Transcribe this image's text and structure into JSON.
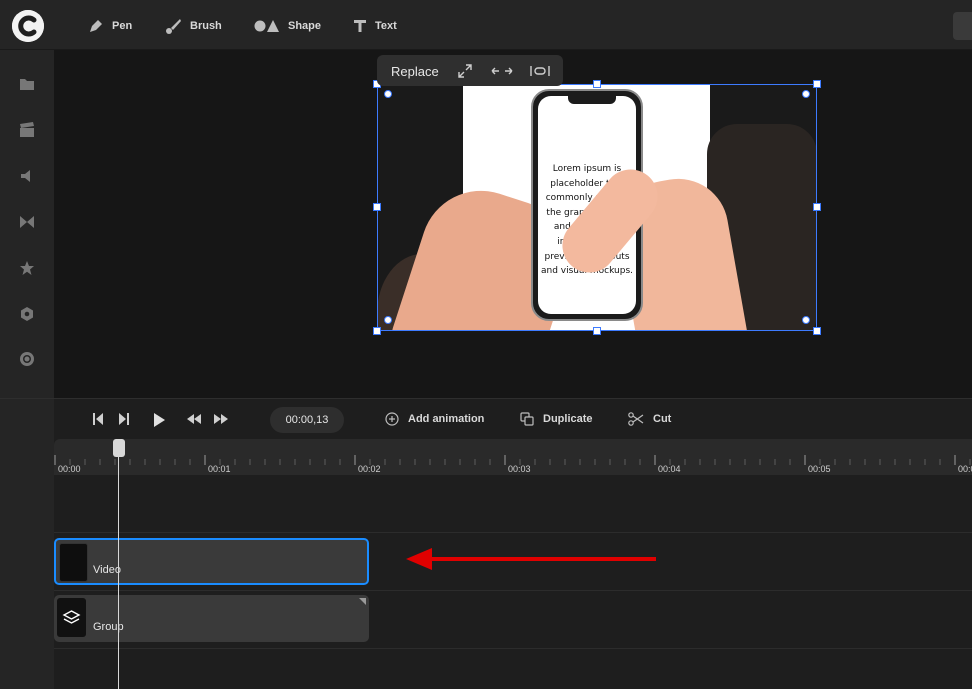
{
  "toolbar": {
    "tools": [
      {
        "label": "Pen",
        "icon": "pen-icon"
      },
      {
        "label": "Brush",
        "icon": "brush-icon"
      },
      {
        "label": "Shape",
        "icon": "shape-icon"
      },
      {
        "label": "Text",
        "icon": "text-icon"
      }
    ]
  },
  "sidebar": {
    "icons": [
      "folder-icon",
      "clapperboard-icon",
      "speaker-icon",
      "transition-icon",
      "star-icon",
      "hexagon-icon",
      "record-icon"
    ]
  },
  "canvas": {
    "floating_toolbar": {
      "replace_label": "Replace"
    },
    "phone_text": "Lorem ipsum is placeholder text commonly used in the graphic, print, and publishing industries for previewing layouts and visual mockups."
  },
  "timeline": {
    "current_time": "00:00,13",
    "actions": {
      "add_animation": "Add animation",
      "duplicate": "Duplicate",
      "cut": "Cut"
    },
    "ruler_labels": [
      "00:00",
      "00:01",
      "00:02",
      "00:03",
      "00:04",
      "00:05",
      "00:0"
    ],
    "tracks": {
      "video_label": "Video",
      "group_label": "Group"
    },
    "highlight_color": "#1a8cff",
    "annotation_arrow_color": "#e00000"
  }
}
